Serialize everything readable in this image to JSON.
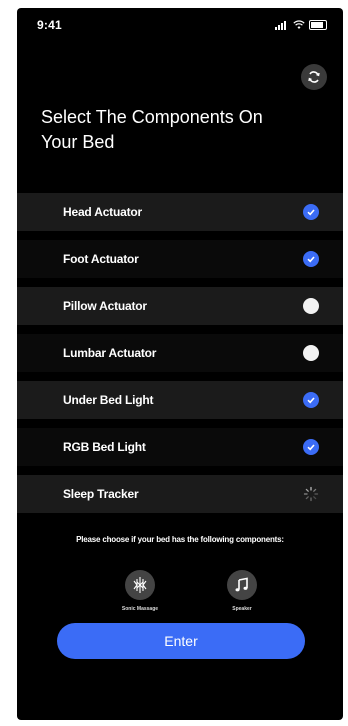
{
  "status_bar": {
    "time": "9:41"
  },
  "header": {
    "title": "Select The Components On Your Bed"
  },
  "components": [
    {
      "label": "Head Actuator",
      "state": "checked"
    },
    {
      "label": "Foot Actuator",
      "state": "checked"
    },
    {
      "label": "Pillow Actuator",
      "state": "unchecked"
    },
    {
      "label": "Lumbar Actuator",
      "state": "unchecked"
    },
    {
      "label": "Under Bed Light",
      "state": "checked"
    },
    {
      "label": "RGB Bed Light",
      "state": "checked"
    },
    {
      "label": "Sleep Tracker",
      "state": "loading"
    }
  ],
  "hint": "Please choose if your bed has the following components:",
  "optional": {
    "sonic_massage": {
      "label": "Sonic Massage",
      "icon": "sonic-wave-icon"
    },
    "speaker": {
      "label": "Speaker",
      "icon": "music-note-icon"
    }
  },
  "enter_button": {
    "label": "Enter"
  },
  "colors": {
    "accent": "#3b6cf6",
    "background": "#000000"
  }
}
